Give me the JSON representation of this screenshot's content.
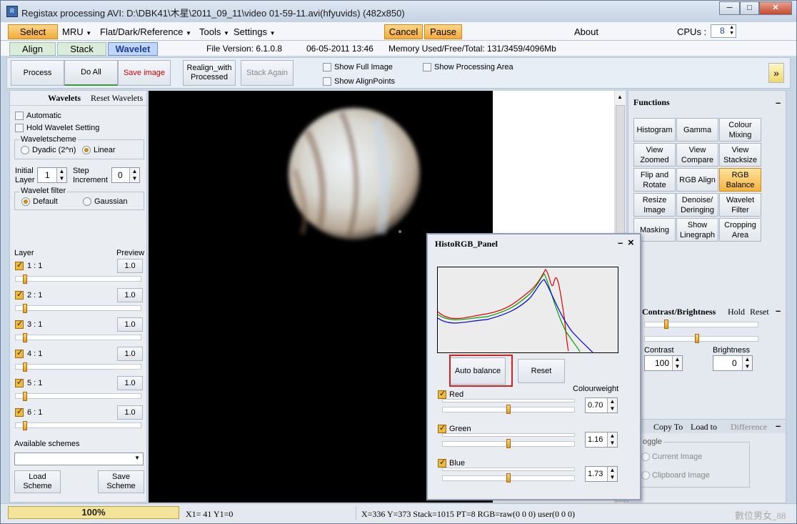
{
  "window": {
    "title": "Registax processing AVI: D:\\DBK41\\木星\\2011_09_11\\video 01-59-11.avi(hfyuvids) (482x850)"
  },
  "menu": {
    "select": "Select",
    "mru": "MRU",
    "flat": "Flat/Dark/Reference",
    "tools": "Tools",
    "settings": "Settings",
    "cancel": "Cancel",
    "pause": "Pause",
    "about": "About",
    "cpus_label": "CPUs :",
    "cpus_value": "8"
  },
  "tabs": {
    "align": "Align",
    "stack": "Stack",
    "wavelet": "Wavelet"
  },
  "info": {
    "file_version": "File Version: 6.1.0.8",
    "date": "06-05-2011 13:46",
    "memory": "Memory Used/Free/Total: 131/3459/4096Mb"
  },
  "toolbar": {
    "process": "Process",
    "do_all": "Do All",
    "save_image": "Save image",
    "realign": "Realign_with Processed",
    "stack_again": "Stack Again",
    "show_full_image": "Show Full Image",
    "show_alignpoints": "Show AlignPoints",
    "show_processing_area": "Show Processing Area",
    "more": "»"
  },
  "wavelets": {
    "header": "Wavelets",
    "reset": "Reset Wavelets",
    "automatic": "Automatic",
    "hold": "Hold Wavelet Setting",
    "scheme_label": "Waveletscheme",
    "dyadic": "Dyadic (2^n)",
    "linear": "Linear",
    "initial_label": "Initial Layer",
    "initial_value": "1",
    "step_label": "Step Increment",
    "step_value": "0",
    "filter_label": "Wavelet filter",
    "default": "Default",
    "gaussian": "Gaussian",
    "layer_col": "Layer",
    "preview_col": "Preview",
    "layers": [
      {
        "name": "1 : 1",
        "value": "1.0"
      },
      {
        "name": "2 : 1",
        "value": "1.0"
      },
      {
        "name": "3 : 1",
        "value": "1.0"
      },
      {
        "name": "4 : 1",
        "value": "1.0"
      },
      {
        "name": "5 : 1",
        "value": "1.0"
      },
      {
        "name": "6 : 1",
        "value": "1.0"
      }
    ],
    "available": "Available schemes",
    "load": "Load Scheme",
    "save": "Save Scheme"
  },
  "functions": {
    "header": "Functions",
    "collapse": "–",
    "buttons": [
      "Histogram",
      "Gamma",
      "Colour Mixing",
      "View Zoomed",
      "View Compare",
      "View Stacksize",
      "Flip and Rotate",
      "RGB Align",
      "RGB Balance",
      "Resize Image",
      "Denoise/ Deringing",
      "Wavelet Filter",
      "Masking",
      "Show Linegraph",
      "Cropping Area"
    ]
  },
  "contrast": {
    "header": "Contrast/Brightness",
    "hold": "Hold",
    "reset": "Reset",
    "contrast_label": "Contrast",
    "contrast_value": "100",
    "brightness_label": "Brightness",
    "brightness_value": "0"
  },
  "copyarea": {
    "copy_to": "Copy To",
    "load_to": "Load to",
    "difference": "Difference",
    "toggle": "oggle",
    "current": "Current Image",
    "clipboard": "Clipboard Image"
  },
  "histo": {
    "title": "HistoRGB_Panel",
    "minimize": "–",
    "close": "×",
    "auto_balance": "Auto balance",
    "reset": "Reset",
    "colourweight": "Colourweight",
    "channels": [
      {
        "name": "Red",
        "value": "0.70",
        "level": 0.5
      },
      {
        "name": "Green",
        "value": "1.16",
        "level": 0.5
      },
      {
        "name": "Blue",
        "value": "1.73",
        "level": 0.5
      }
    ],
    "colors": {
      "red": "#e00000",
      "green": "#00a000",
      "blue": "#0000e0"
    }
  },
  "status": {
    "progress": "100%",
    "xy": "X1= 41 Y1=0",
    "coords": "X=336 Y=373 Stack=1015 PT=8 RGB=raw(0 0 0) user(0 0 0)",
    "watermark": "數位男女_88"
  }
}
